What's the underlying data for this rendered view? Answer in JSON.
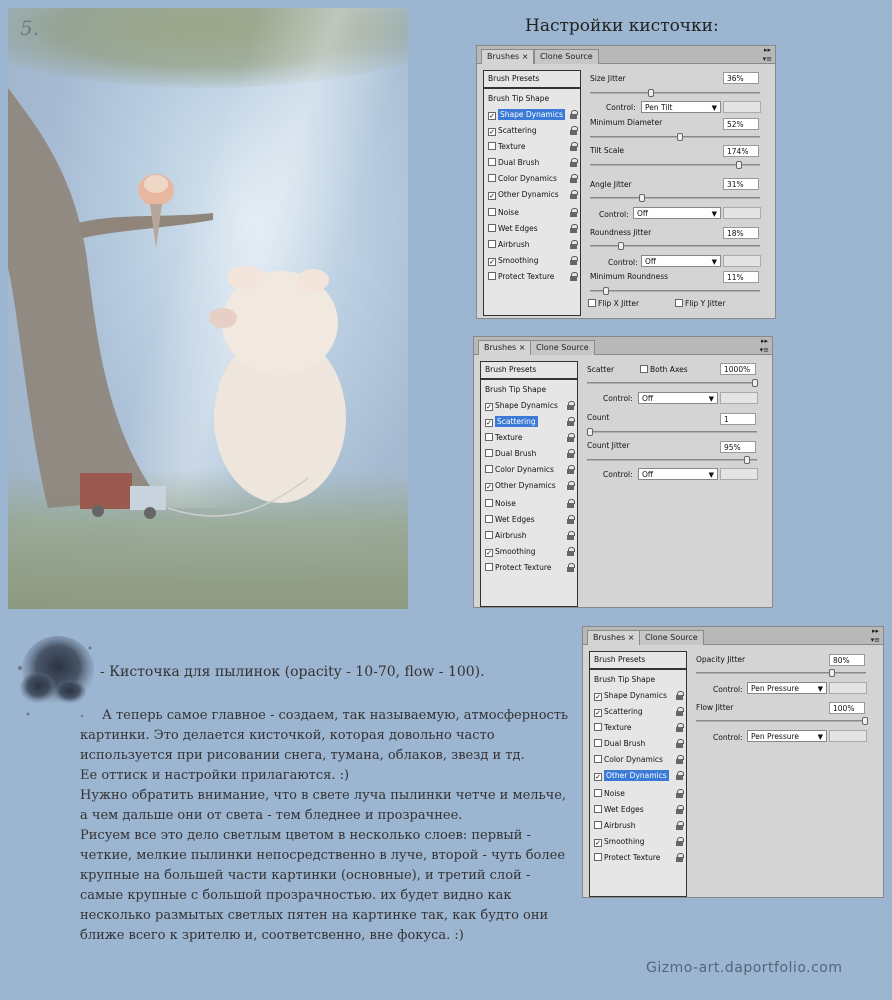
{
  "painting": {
    "number": "5."
  },
  "heading": "Настройки кисточки:",
  "panels": {
    "tabs": {
      "brushes": "Brushes ×",
      "clone": "Clone Source"
    },
    "presets": "Brush Presets",
    "list_items": [
      "Brush Tip Shape",
      "Shape Dynamics",
      "Scattering",
      "Texture",
      "Dual Brush",
      "Color Dynamics",
      "Other Dynamics",
      "Noise",
      "Wet Edges",
      "Airbrush",
      "Smoothing",
      "Protect Texture"
    ],
    "p1": {
      "size_jitter": "Size Jitter",
      "size_jitter_val": "36%",
      "control": "Control:",
      "control_val1": "Pen Tilt",
      "min_diam": "Minimum Diameter",
      "min_diam_val": "52%",
      "tilt": "Tilt Scale",
      "tilt_val": "174%",
      "angle": "Angle Jitter",
      "angle_val": "31%",
      "control_val2": "Off",
      "round": "Roundness Jitter",
      "round_val": "18%",
      "control_val3": "Off",
      "min_round": "Minimum Roundness",
      "min_round_val": "11%",
      "flipx": "Flip X Jitter",
      "flipy": "Flip Y Jitter"
    },
    "p2": {
      "scatter": "Scatter",
      "both_axes": "Both Axes",
      "scatter_val": "1000%",
      "control": "Control:",
      "control_val1": "Off",
      "count": "Count",
      "count_val": "1",
      "count_jitter": "Count Jitter",
      "count_jitter_val": "95%",
      "control_val2": "Off"
    },
    "p3": {
      "opacity": "Opacity Jitter",
      "opacity_val": "80%",
      "control": "Control:",
      "control_val1": "Pen Pressure",
      "flow": "Flow Jitter",
      "flow_val": "100%",
      "control_val2": "Pen Pressure"
    }
  },
  "brush_label": "- Кисточка для пылинок (opacity - 10-70, flow - 100).",
  "body": [
    "А теперь самое главное - создаем, так называемую, атмосферность картинки. Это делается кисточкой, которая довольно часто используется при рисовании снега, тумана, облаков, звезд и тд.",
    "Ее оттиск и настройки прилагаются. :)",
    "Нужно обратить внимание, что в свете луча пылинки четче и мельче, а чем дальше они от света - тем бледнее и прозрачнее.",
    "Рисуем все это дело светлым цветом в несколько слоев: первый - четкие, мелкие пылинки непосредственно в луче, второй - чуть более крупные на большей части картинки (основные), и третий слой - самые крупные с большой прозрачностью. их будет видно как несколько размытых светлых пятен на картинке так, как будто они ближе всего к зрителю и, соответсвенно, вне фокуса. :)"
  ],
  "watermark": "Gizmo-art.daportfolio.com"
}
